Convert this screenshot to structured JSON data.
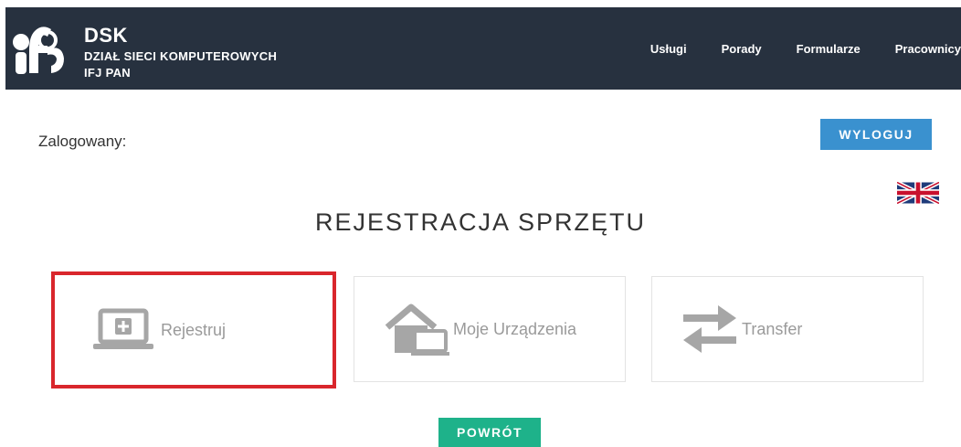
{
  "header": {
    "brand_title": "DSK",
    "brand_line1": "DZIAŁ SIECI KOMPUTEROWYCH",
    "brand_line2": "IFJ PAN",
    "nav": [
      "Usługi",
      "Porady",
      "Formularze",
      "Pracownicy"
    ],
    "bar_color": "#27313f"
  },
  "session": {
    "logged_label": "Zalogowany:",
    "logout_label": "WYLOGUJ"
  },
  "language_flag": "uk-flag-icon",
  "page": {
    "title": "REJESTRACJA SPRZĘTU"
  },
  "cards": [
    {
      "label": "Rejestruj",
      "icon": "laptop-plus-icon",
      "selected": true
    },
    {
      "label": "Moje Urządzenia",
      "icon": "home-devices-icon",
      "selected": false
    },
    {
      "label": "Transfer",
      "icon": "transfer-arrows-icon",
      "selected": false
    }
  ],
  "back_label": "POWRÓT",
  "colors": {
    "logout": "#3a91cf",
    "back": "#1eb28a",
    "selection": "#d9262c",
    "icon_gray": "#a6a6a6"
  }
}
